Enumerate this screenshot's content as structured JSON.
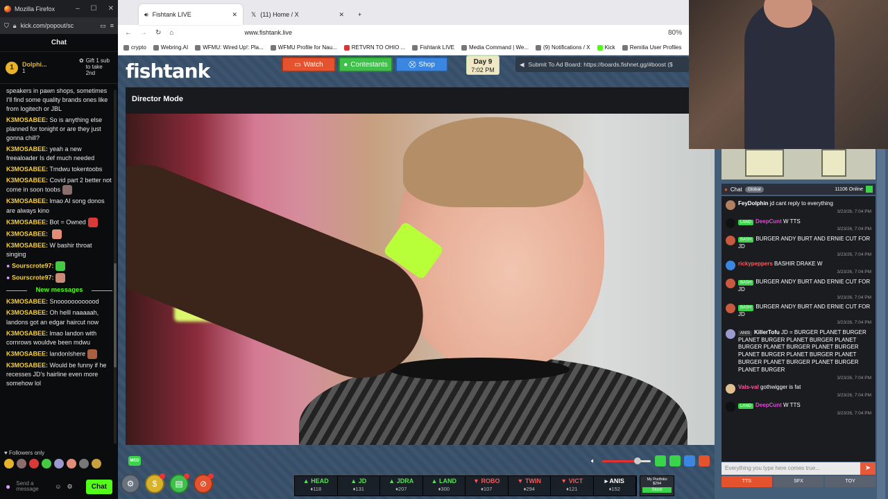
{
  "kick": {
    "window_title": "Mozilla Firefox",
    "url": "kick.com/popout/sc",
    "chat_title": "Chat",
    "pinned": {
      "rank": "1",
      "name": "Dolphi...",
      "count": "1",
      "gift_text": "Gift 1 sub to take 2nd"
    },
    "messages": [
      {
        "user": "",
        "text": "speakers in pawn shops, sometimes I'll find some quality brands ones like from logitech or JBL"
      },
      {
        "user": "K3MOSABEE:",
        "text": "So is anything else planned for tonight or are they just gonna chill?"
      },
      {
        "user": "K3MOSABEE:",
        "text": "yeah a new freealoader Is def much needed"
      },
      {
        "user": "K3MOSABEE:",
        "text": "Tmdwu tokentoobs"
      },
      {
        "user": "K3MOSABEE:",
        "text": "Covid part 2 better not come in soon toobs"
      },
      {
        "user": "K3MOSABEE:",
        "text": "lmao AI song donos are always kino"
      },
      {
        "user": "K3MOSABEE:",
        "text": "Bot = Owned"
      },
      {
        "user": "K3MOSABEE:",
        "text": ""
      },
      {
        "user": "K3MOSABEE:",
        "text": "W bashir throat singing"
      },
      {
        "user": "Sourscrote97:",
        "text": ""
      },
      {
        "user": "Sourscrote97:",
        "text": ""
      }
    ],
    "new_messages_label": "New messages",
    "messages_after": [
      {
        "user": "K3MOSABEE:",
        "text": "Snoooooooooood"
      },
      {
        "user": "K3MOSABEE:",
        "text": "Oh helll naaaaah, landons got an edgar haircut now"
      },
      {
        "user": "K3MOSABEE:",
        "text": "lmao landon with cornrows wouldve been mdwu"
      },
      {
        "user": "K3MOSABEE:",
        "text": "landonlshere"
      },
      {
        "user": "K3MOSABEE:",
        "text": "Would be funny if he recesses JD's hairline even more somehow lol"
      }
    ],
    "followers_only": "Followers only",
    "send_placeholder": "Send a message",
    "chat_button": "Chat"
  },
  "browser": {
    "tabs": [
      {
        "label": "Fishtank LIVE",
        "active": true
      },
      {
        "label": "(11) Home / X",
        "active": false
      }
    ],
    "address": "www.fishtank.live",
    "zoom": "80%",
    "bookmarks": [
      "crypto",
      "Webring.AI",
      "WFMU: Wired Up!: Pla...",
      "WFMU Profile for Nau...",
      "RETVRN TO OHIO ...",
      "Fishtank LIVE",
      "Media Command | We...",
      "(9) Notifications / X",
      "Kick",
      "Remilia User Profiles"
    ]
  },
  "fishtank": {
    "logo": "fishtank",
    "buttons": {
      "watch": "Watch",
      "contestants": "Contestants",
      "shop": "Shop"
    },
    "day": {
      "label": "Day 9",
      "time": "7:02 PM"
    },
    "ad_board": "Submit To Ad Board: https://boards.fishnet.gg/#boost ($",
    "director_mode": "Director Mode",
    "quality": "MED",
    "contestants": [
      {
        "name": "HEAD",
        "points": "118",
        "trend": "up"
      },
      {
        "name": "JD",
        "points": "131",
        "trend": "up"
      },
      {
        "name": "JDRA",
        "points": "207",
        "trend": "up"
      },
      {
        "name": "LAND",
        "points": "300",
        "trend": "up"
      },
      {
        "name": "ROBO",
        "points": "107",
        "trend": "down"
      },
      {
        "name": "TWIN",
        "points": "294",
        "trend": "down"
      },
      {
        "name": "VICT",
        "points": "121",
        "trend": "down"
      },
      {
        "name": "ANIS",
        "points": "152",
        "trend": "neutral"
      }
    ],
    "portfolio": {
      "title": "My Portfolio",
      "value": "$294",
      "stock": "Stock"
    },
    "colors": {
      "watch": "#e4532e",
      "contestants": "#3ec04a",
      "shop": "#3a86e0",
      "bg": "#374e68"
    }
  },
  "rightchat": {
    "title": "Chat",
    "tab": "Global",
    "online": "11106 Online",
    "messages": [
      {
        "user": "FeyDolphin",
        "badge": "",
        "text": "jd cant reply to everything",
        "time": "3/23/26, 7:04 PM",
        "color": "#ffffff"
      },
      {
        "user": "DeepCunt",
        "badge": "LAND",
        "text": "W TTS",
        "time": "3/23/26, 7:04 PM",
        "color": "#e04ad6"
      },
      {
        "user": "",
        "badge": "BASH",
        "text": "BURGER ANDY BURT AND ERNIE CUT FOR JD",
        "time": "3/23/26, 7:04 PM",
        "color": "#3ad34a"
      },
      {
        "user": "rickypeppers",
        "badge": "",
        "text": "BASHIR DRAKE W",
        "time": "3/23/26, 7:04 PM",
        "color": "#ff5a5a"
      },
      {
        "user": "",
        "badge": "BASH",
        "text": "BURGER ANDY BURT AND ERNIE CUT FOR JD",
        "time": "3/23/26, 7:04 PM",
        "color": "#3ad34a"
      },
      {
        "user": "",
        "badge": "BASH",
        "text": "BURGER ANDY BURT AND ERNIE CUT FOR JD",
        "time": "3/23/26, 7:04 PM",
        "color": "#3ad34a"
      },
      {
        "user": "KillerTofu",
        "badge": "ANIS",
        "text": "JD = BURGER PLANET BURGER PLANET BURGER PLANET BURGER PLANET BURGER PLANET BURGER PLANET BURGER PLANET BURGER PLANET BURGER PLANET BURGER PLANET BURGER PLANET BURGER PLANET BURGER",
        "time": "3/23/26, 7:04 PM",
        "color": "#ffffff"
      },
      {
        "user": "Vals-val",
        "badge": "",
        "text": "gothwigger is fat",
        "time": "3/23/26, 7:04 PM",
        "color": "#ff5aa0"
      },
      {
        "user": "DeepCunt",
        "badge": "LAND",
        "text": "W TTS",
        "time": "3/23/26, 7:04 PM",
        "color": "#e04ad6"
      }
    ],
    "input_placeholder": "Everything you type here comes true...",
    "bottom_tabs": [
      "TTS",
      "SFX",
      "TOY"
    ]
  }
}
